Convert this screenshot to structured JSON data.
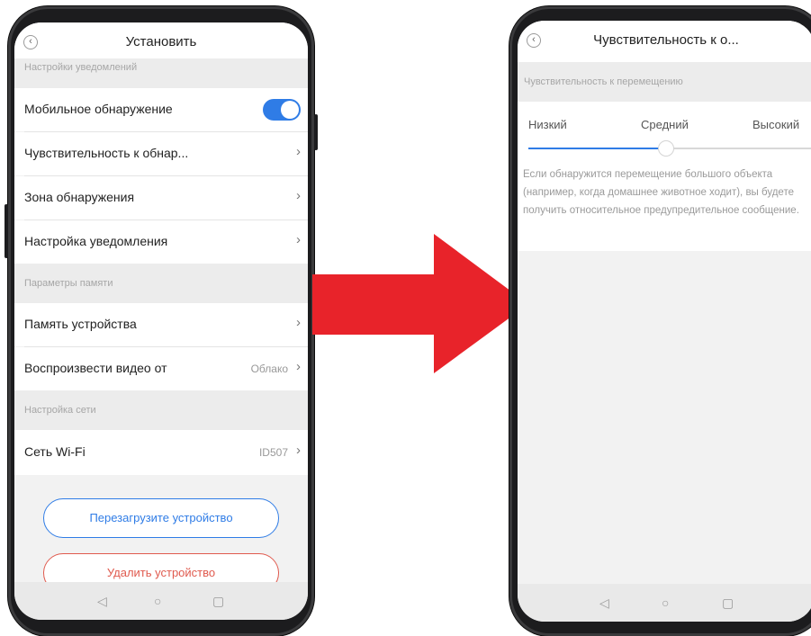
{
  "left_screen": {
    "title": "Установить",
    "sections": {
      "notifications": "Настройки уведомлений",
      "memory": "Параметры памяти",
      "network": "Настройка сети"
    },
    "rows": {
      "mobile_detection": "Мобильное обнаружение",
      "sensitivity": "Чувствительность к обнар...",
      "detection_zone": "Зона обнаружения",
      "notification_setting": "Настройка уведомления",
      "device_memory": "Память устройства",
      "playback_label": "Воспроизвести видео от",
      "playback_value": "Облако",
      "wifi_label": "Сеть Wi-Fi",
      "wifi_value": "ID507"
    },
    "mobile_detection_enabled": true,
    "buttons": {
      "restart": "Перезагрузите устройство",
      "delete": "Удалить устройство"
    }
  },
  "right_screen": {
    "title": "Чувствительность к о...",
    "section": "Чувствительность к перемещению",
    "levels": [
      "Низкий",
      "Средний",
      "Высокий"
    ],
    "selected_level": "Средний",
    "description": "Если обнаружится перемещение большого объекта (например, когда домашнее животное ходит), вы будете получить относительное предупредительное сообщение."
  },
  "colors": {
    "accent": "#2f7ce6",
    "danger": "#e05a4e",
    "arrow": "#e8232a"
  },
  "icons": {
    "back": "chevron-left-icon",
    "chevron": "chevron-right-icon",
    "nav_back": "triangle-back-icon",
    "nav_home": "circle-home-icon",
    "nav_recent": "square-recent-icon"
  }
}
